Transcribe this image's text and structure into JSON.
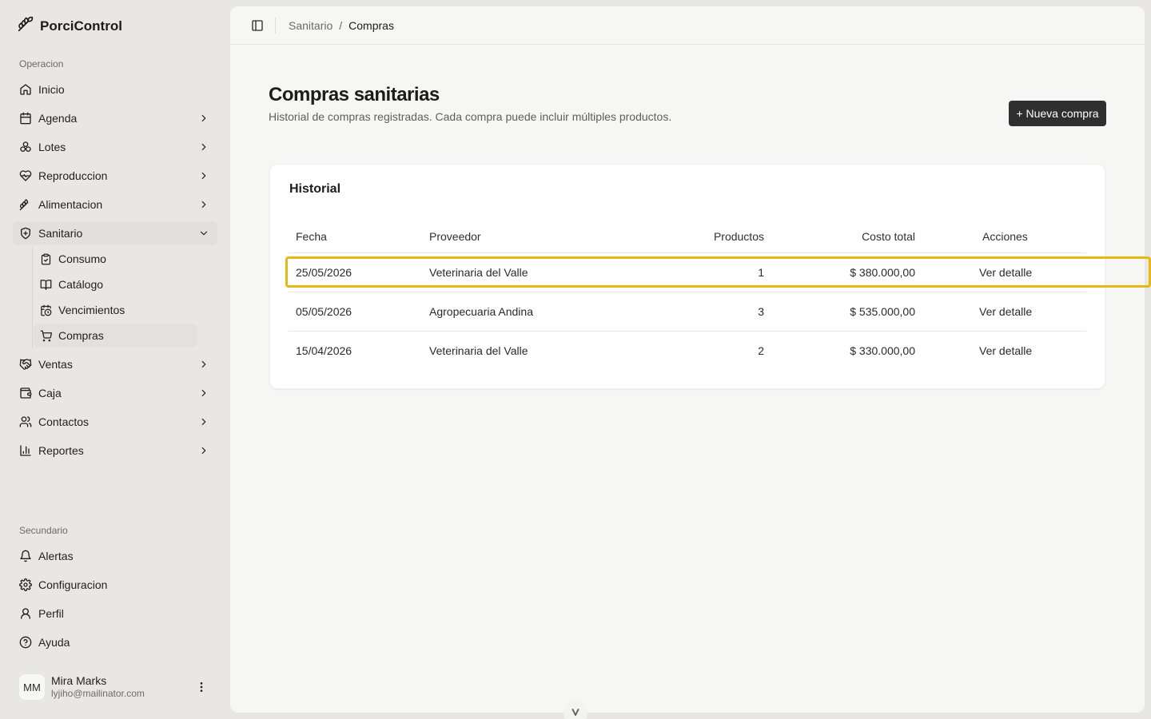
{
  "app": {
    "name": "PorciControl"
  },
  "sidebar": {
    "section_operacion": "Operacion",
    "items": [
      {
        "label": "Inicio",
        "icon": "home-icon"
      },
      {
        "label": "Agenda",
        "icon": "calendar-icon"
      },
      {
        "label": "Lotes",
        "icon": "group-icon"
      },
      {
        "label": "Reproduccion",
        "icon": "heart-pulse-icon"
      },
      {
        "label": "Alimentacion",
        "icon": "wheat-icon"
      },
      {
        "label": "Sanitario",
        "icon": "shield-plus-icon"
      }
    ],
    "sanitario_sub": [
      {
        "label": "Consumo",
        "icon": "clipboard-check-icon"
      },
      {
        "label": "Catálogo",
        "icon": "book-open-icon"
      },
      {
        "label": "Vencimientos",
        "icon": "calendar-clock-icon"
      },
      {
        "label": "Compras",
        "icon": "cart-icon"
      }
    ],
    "items_after": [
      {
        "label": "Ventas",
        "icon": "handshake-icon"
      },
      {
        "label": "Caja",
        "icon": "wallet-icon"
      },
      {
        "label": "Contactos",
        "icon": "users-icon"
      },
      {
        "label": "Reportes",
        "icon": "bar-chart-icon"
      }
    ],
    "section_secundario": "Secundario",
    "secondary": [
      {
        "label": "Alertas",
        "icon": "bell-icon"
      },
      {
        "label": "Configuracion",
        "icon": "gear-icon"
      },
      {
        "label": "Perfil",
        "icon": "user-icon"
      },
      {
        "label": "Ayuda",
        "icon": "help-circle-icon"
      }
    ],
    "user": {
      "initials": "MM",
      "name": "Mira Marks",
      "email": "lyjiho@mailinator.com"
    }
  },
  "topbar": {
    "crumb_parent": "Sanitario",
    "crumb_sep": "/",
    "crumb_current": "Compras"
  },
  "page": {
    "title": "Compras sanitarias",
    "subtitle": "Historial de compras registradas. Cada compra puede incluir múltiples productos.",
    "new_button": "+ Nueva compra"
  },
  "table": {
    "title": "Historial",
    "columns": [
      "Fecha",
      "Proveedor",
      "Productos",
      "Costo total",
      "Acciones"
    ],
    "rows": [
      {
        "fecha": "25/05/2026",
        "proveedor": "Veterinaria del Valle",
        "productos": "1",
        "costo": "$ 380.000,00",
        "accion": "Ver detalle"
      },
      {
        "fecha": "05/05/2026",
        "proveedor": "Agropecuaria Andina",
        "productos": "3",
        "costo": "$ 535.000,00",
        "accion": "Ver detalle"
      },
      {
        "fecha": "15/04/2026",
        "proveedor": "Veterinaria del Valle",
        "productos": "2",
        "costo": "$ 330.000,00",
        "accion": "Ver detalle"
      }
    ]
  },
  "colors": {
    "highlight": "#e8b714",
    "button": "#2f2f2f",
    "sidebar_bg": "#e8e7e4"
  }
}
